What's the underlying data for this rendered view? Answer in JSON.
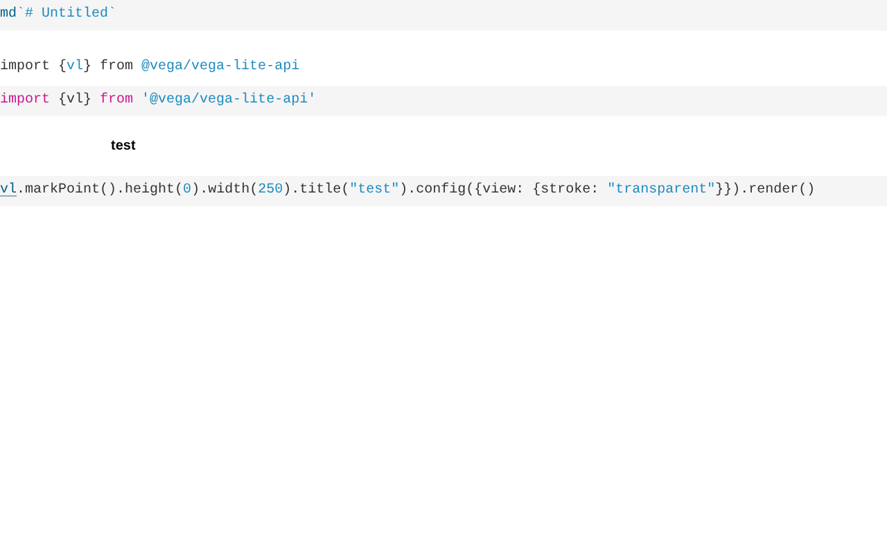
{
  "rows": [
    {
      "kind": "cell",
      "tokens": [
        {
          "kind": "tag",
          "text": "md"
        },
        {
          "kind": "string",
          "text": "`# Untitled`"
        }
      ]
    },
    {
      "kind": "spacer"
    },
    {
      "kind": "output",
      "tokens": [
        {
          "kind": "plain",
          "text": "import {"
        },
        {
          "kind": "name",
          "text": "vl"
        },
        {
          "kind": "plain",
          "text": "} from "
        },
        {
          "kind": "string",
          "text": "@vega/vega-lite-api"
        }
      ]
    },
    {
      "kind": "cell",
      "tokens": [
        {
          "kind": "keyword",
          "text": "import"
        },
        {
          "kind": "plain",
          "text": " {vl} "
        },
        {
          "kind": "keyword",
          "text": "from"
        },
        {
          "kind": "string",
          "text": " '@vega/vega-lite-api'"
        }
      ]
    },
    {
      "kind": "chart_title",
      "text": "test"
    },
    {
      "kind": "cell",
      "tokens": [
        {
          "kind": "ref",
          "text": "vl"
        },
        {
          "kind": "plain",
          "text": ".markPoint().height("
        },
        {
          "kind": "number",
          "text": "0"
        },
        {
          "kind": "plain",
          "text": ").width("
        },
        {
          "kind": "number",
          "text": "250"
        },
        {
          "kind": "plain",
          "text": ").title("
        },
        {
          "kind": "string",
          "text": "\"test\""
        },
        {
          "kind": "plain",
          "text": ").config({view: {stroke: "
        },
        {
          "kind": "string",
          "text": "\"transparent\""
        },
        {
          "kind": "plain",
          "text": "}}).render()"
        }
      ]
    }
  ]
}
